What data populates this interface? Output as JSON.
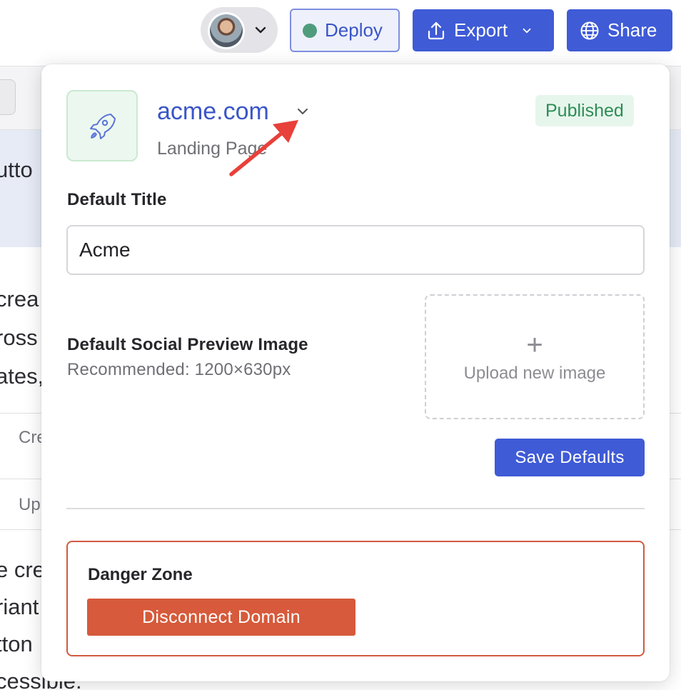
{
  "toolbar": {
    "deploy_label": "Deploy",
    "export_label": "Export",
    "share_label": "Share"
  },
  "background": {
    "lines": [
      "utto",
      "crea",
      "ross",
      "ates,",
      "e cre",
      "riant",
      "tton",
      "cessible."
    ],
    "rows": [
      "Cre",
      "Up"
    ]
  },
  "popover": {
    "site_name": "acme.com",
    "site_type": "Landing Page",
    "status": "Published",
    "title_label": "Default Title",
    "title_value": "Acme",
    "image_label": "Default Social Preview Image",
    "image_hint": "Recommended: 1200×630px",
    "upload_label": "Upload new image",
    "save_label": "Save Defaults",
    "danger_title": "Danger Zone",
    "disconnect_label": "Disconnect Domain"
  },
  "icons": {
    "avatar": "user-avatar",
    "avatar_menu": "chevron-down-icon",
    "deploy_status": "status-dot-icon",
    "export": "upload-icon",
    "share": "globe-icon",
    "site": "rocket-icon",
    "site_menu": "chevron-down-icon",
    "annotation": "red-arrow-icon",
    "upload": "plus-icon"
  },
  "colors": {
    "primary": "#3f5bd6",
    "published_bg": "#e7f6ec",
    "published_text": "#2e8c57",
    "danger": "#d65a3b",
    "annotation_arrow": "#e8403a"
  }
}
